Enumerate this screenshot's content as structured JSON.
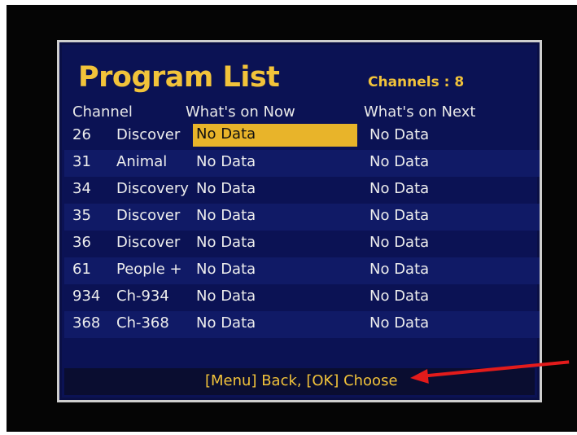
{
  "app": {
    "title": "Program List",
    "channels_label": "Channels : 8"
  },
  "columns": {
    "channel": "Channel",
    "now": "What's on Now",
    "next": "What's on Next"
  },
  "rows": [
    {
      "num": "26",
      "name": "Discover",
      "now": "No Data",
      "next": "No Data",
      "selected": true
    },
    {
      "num": "31",
      "name": "Animal",
      "now": "No Data",
      "next": "No Data"
    },
    {
      "num": "34",
      "name": "Discovery",
      "now": "No Data",
      "next": "No Data"
    },
    {
      "num": "35",
      "name": "Discover",
      "now": "No Data",
      "next": "No Data"
    },
    {
      "num": "36",
      "name": "Discover",
      "now": "No Data",
      "next": "No Data"
    },
    {
      "num": "61",
      "name": "People +",
      "now": "No Data",
      "next": "No Data"
    },
    {
      "num": "934",
      "name": "Ch-934",
      "now": "No Data",
      "next": "No Data"
    },
    {
      "num": "368",
      "name": "Ch-368",
      "now": "No Data",
      "next": "No Data"
    }
  ],
  "footer": {
    "hint": "[Menu] Back, [OK] Choose"
  },
  "colors": {
    "accent": "#f2c33a",
    "panel_bg": "#0b1254",
    "selection": "#e8b42a",
    "annotation_arrow": "#e31b1b"
  },
  "icons": {
    "annotation": "red-arrow-icon"
  }
}
